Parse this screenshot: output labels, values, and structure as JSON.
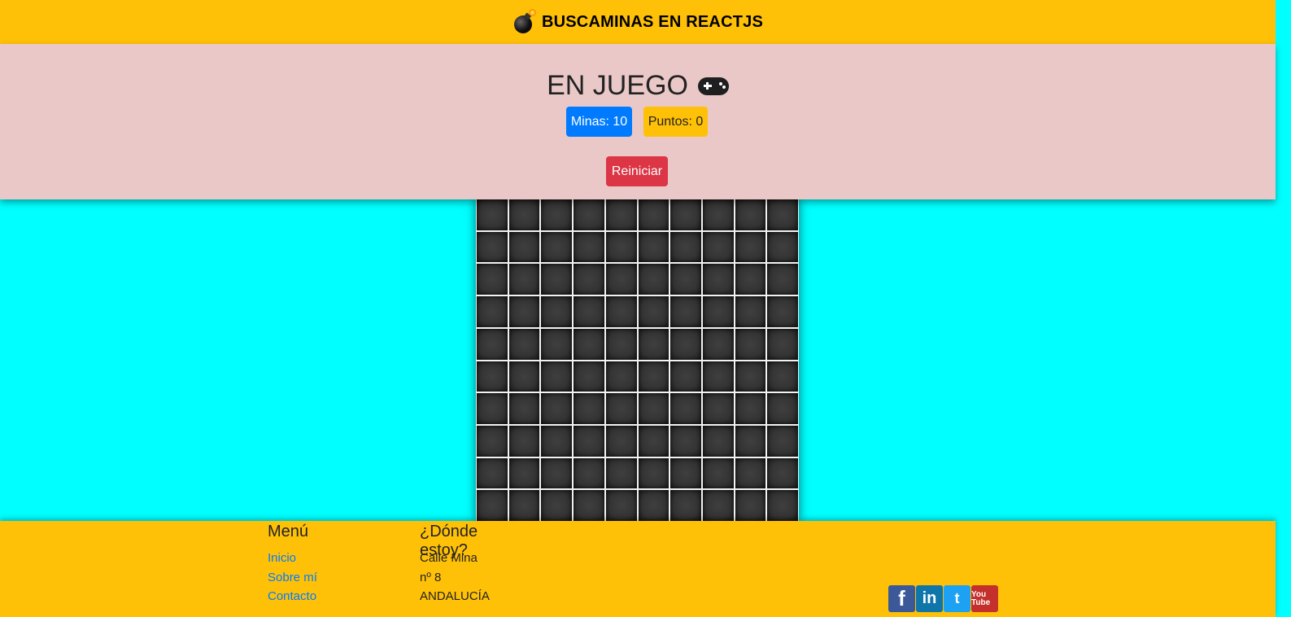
{
  "header": {
    "brand_title": "BUSCAMINAS EN REACTJS",
    "brand_icon": "bomb-icon"
  },
  "status": {
    "title": "EN JUEGO",
    "title_icon": "gamepad-icon",
    "mines_label": "Minas: 10",
    "points_label": "Puntos: 0",
    "restart_label": "Reiniciar"
  },
  "board": {
    "rows": 10,
    "cols": 10,
    "cell_state": "covered"
  },
  "footer": {
    "menu_title": "Menú",
    "menu_links": [
      "Inicio",
      "Sobre mí",
      "Contacto"
    ],
    "where_title": "¿Dónde estoy?",
    "address_lines": [
      "Calle Mina",
      "nº 8",
      "ANDALUCÍA"
    ],
    "social": [
      {
        "name": "facebook-icon",
        "glyph": "f"
      },
      {
        "name": "linkedin-icon",
        "glyph": "in"
      },
      {
        "name": "twitter-icon",
        "glyph": "t"
      },
      {
        "name": "youtube-icon",
        "glyph": "You Tube"
      }
    ]
  },
  "colors": {
    "navbar": "#ffc107",
    "status_panel": "#eac8c8",
    "background": "#00ffff",
    "mines_badge": "#007bff",
    "points_badge": "#ffc107",
    "restart_button": "#dc3545"
  }
}
